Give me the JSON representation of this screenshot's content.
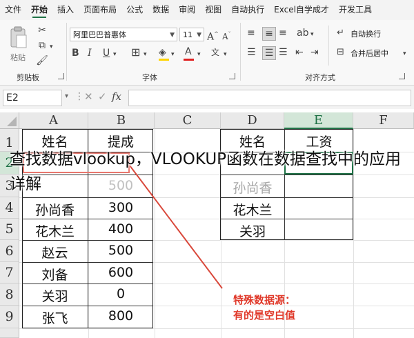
{
  "menubar": {
    "tabs": [
      "文件",
      "开始",
      "插入",
      "页面布局",
      "公式",
      "数据",
      "审阅",
      "视图",
      "自动执行",
      "Excel自学成才",
      "开发工具"
    ],
    "active": "开始"
  },
  "ribbon": {
    "clipboard": {
      "paste_label": "粘贴",
      "group_label": "剪贴板"
    },
    "font": {
      "font_name": "阿里巴巴普惠体",
      "font_size": "11",
      "group_label": "字体"
    },
    "alignment": {
      "wrap_label": "自动换行",
      "merge_label": "合并后居中",
      "group_label": "对齐方式"
    }
  },
  "formula_bar": {
    "name_box": "E2",
    "fx": "fx",
    "formula": ""
  },
  "sheet": {
    "columns": [
      "A",
      "B",
      "C",
      "D",
      "E",
      "F"
    ],
    "selected_column": "E",
    "rows": [
      "1",
      "2",
      "3",
      "4",
      "5",
      "6",
      "7",
      "8",
      "9"
    ],
    "selected_row": "2",
    "left_table": {
      "headers": [
        "姓名",
        "提成"
      ],
      "rows": [
        [
          "",
          ""
        ],
        [
          "",
          "500"
        ],
        [
          "孙尚香",
          "300"
        ],
        [
          "花木兰",
          "400"
        ],
        [
          "赵云",
          "500"
        ],
        [
          "刘备",
          "600"
        ],
        [
          "关羽",
          "0"
        ],
        [
          "张飞",
          "800"
        ]
      ]
    },
    "right_table": {
      "headers": [
        "姓名",
        "工资"
      ],
      "rows": [
        [
          "",
          ""
        ],
        [
          "孙尚香",
          ""
        ],
        [
          "花木兰",
          ""
        ],
        [
          "关羽",
          ""
        ]
      ]
    }
  },
  "caption": "查找数据vlookup，VLOOKUP函数在数据查找中的应用详解",
  "annotation": {
    "line1": "特殊数据源：",
    "line2": "有的是空白值",
    "color": "#e03a2b"
  },
  "colors": {
    "accent": "#1e7145",
    "annotation_red": "#e03a2b"
  }
}
